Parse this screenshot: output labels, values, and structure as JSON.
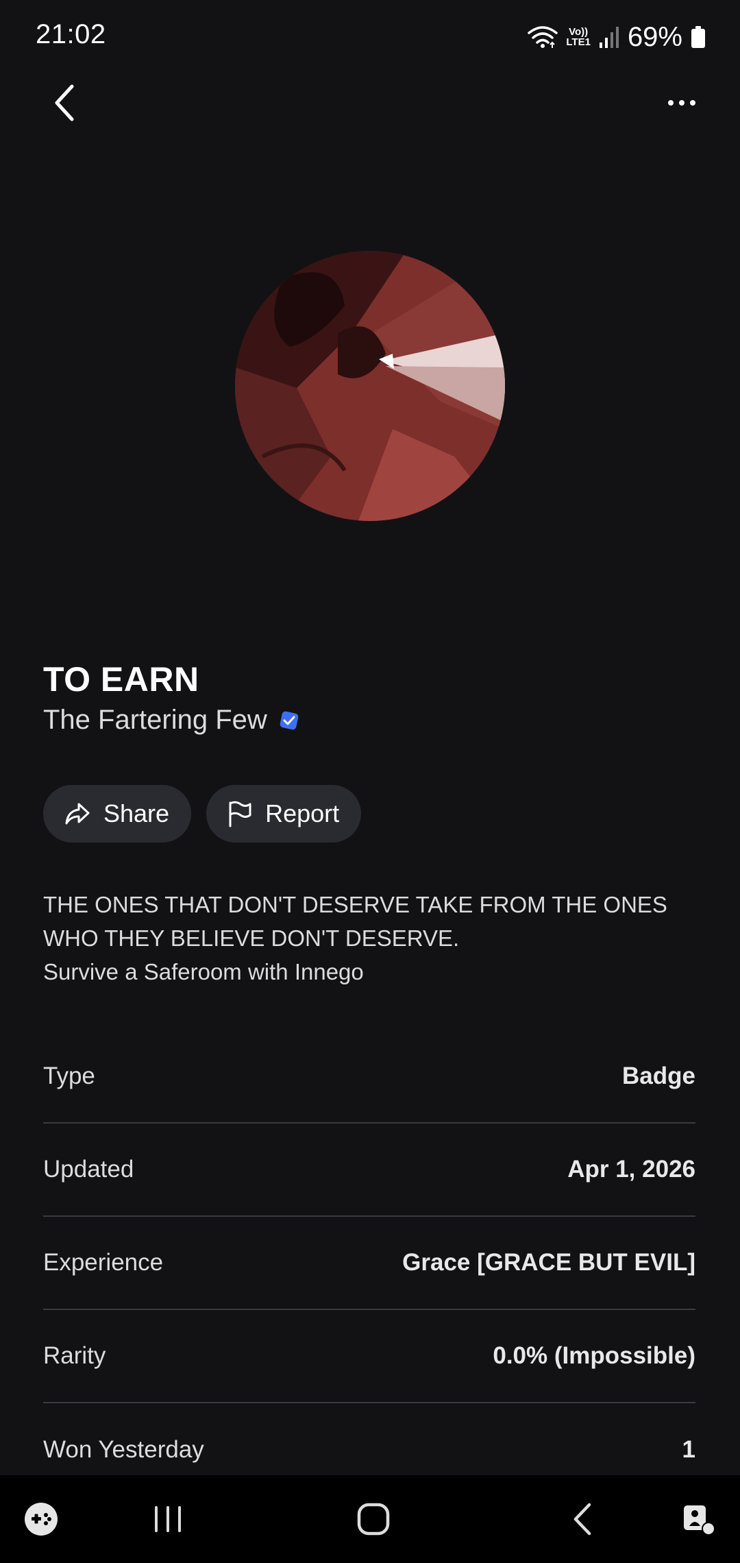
{
  "status_bar": {
    "time": "21:02",
    "network_label": "Vo))\nLTE1",
    "battery_text": "69%"
  },
  "icons": {
    "back": "chevron-left-icon",
    "more": "more-horizontal-icon",
    "verified": "verified-badge-icon",
    "share": "share-arrow-icon",
    "report": "flag-icon"
  },
  "badge": {
    "title": "TO EARN",
    "creator": "The Fartering Few",
    "creator_verified": true
  },
  "actions": {
    "share_label": "Share",
    "report_label": "Report"
  },
  "description": {
    "line1": "THE ONES THAT DON'T DESERVE TAKE FROM THE ONES WHO THEY BELIEVE DON'T DESERVE.",
    "line2": "Survive a Saferoom with Innego"
  },
  "details": [
    {
      "label": "Type",
      "value": "Badge"
    },
    {
      "label": "Updated",
      "value": "Apr 1, 2026"
    },
    {
      "label": "Experience",
      "value": "Grace [GRACE BUT EVIL]"
    },
    {
      "label": "Rarity",
      "value": "0.0% (Impossible)"
    },
    {
      "label": "Won Yesterday",
      "value": "1"
    }
  ],
  "colors": {
    "background": "#121215",
    "pill": "#2a2b30",
    "divider": "#3a3b40",
    "verified_blue": "#3d6ef5",
    "badge_red": "#8f3a36"
  }
}
